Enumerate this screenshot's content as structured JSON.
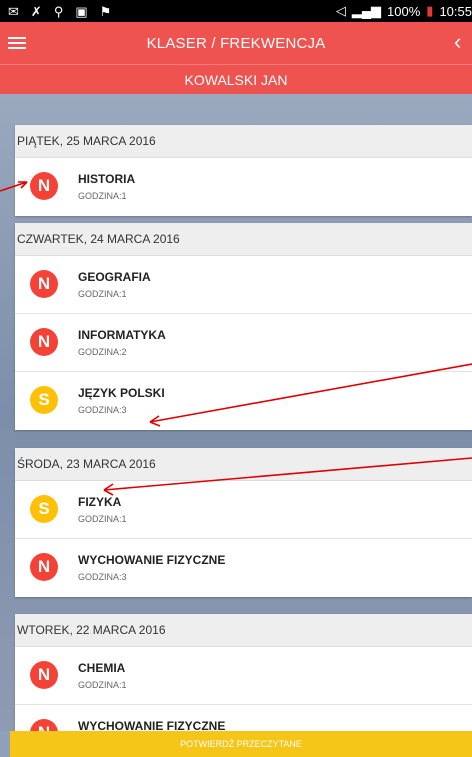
{
  "statusbar": {
    "battery": "100%",
    "time": "10:55"
  },
  "header": {
    "title": "KLASER / FREKWENCJA",
    "student": "KOWALSKI JAN"
  },
  "days": [
    {
      "date": "PIĄTEK, 25 MARCA 2016",
      "lessons": [
        {
          "status": "N",
          "subject": "HISTORIA",
          "hour": "GODZINA:1"
        }
      ]
    },
    {
      "date": "CZWARTEK, 24 MARCA 2016",
      "lessons": [
        {
          "status": "N",
          "subject": "GEOGRAFIA",
          "hour": "GODZINA:1"
        },
        {
          "status": "N",
          "subject": "INFORMATYKA",
          "hour": "GODZINA:2"
        },
        {
          "status": "S",
          "subject": "JĘZYK POLSKI",
          "hour": "GODZINA:3"
        }
      ]
    },
    {
      "date": "ŚRODA, 23 MARCA 2016",
      "lessons": [
        {
          "status": "S",
          "subject": "FIZYKA",
          "hour": "GODZINA:1"
        },
        {
          "status": "N",
          "subject": "WYCHOWANIE FIZYCZNE",
          "hour": "GODZINA:3"
        }
      ]
    },
    {
      "date": "WTOREK, 22 MARCA 2016",
      "lessons": [
        {
          "status": "N",
          "subject": "CHEMIA",
          "hour": "GODZINA:1"
        },
        {
          "status": "N",
          "subject": "WYCHOWANIE FIZYCZNE",
          "hour": ""
        }
      ]
    }
  ],
  "footer": {
    "confirm_label": "POTWIERDŹ PRZECZYTANE"
  },
  "colors": {
    "primary": "#ef5350",
    "absent": "#f44336",
    "late": "#ffc107",
    "confirm": "#f5c518",
    "annotation_arrow": "#e00000"
  },
  "icons": [
    "menu-icon",
    "back-icon",
    "mail-icon",
    "missed-call-icon",
    "usb-icon",
    "gallery-icon",
    "signal-icon",
    "battery-icon"
  ]
}
